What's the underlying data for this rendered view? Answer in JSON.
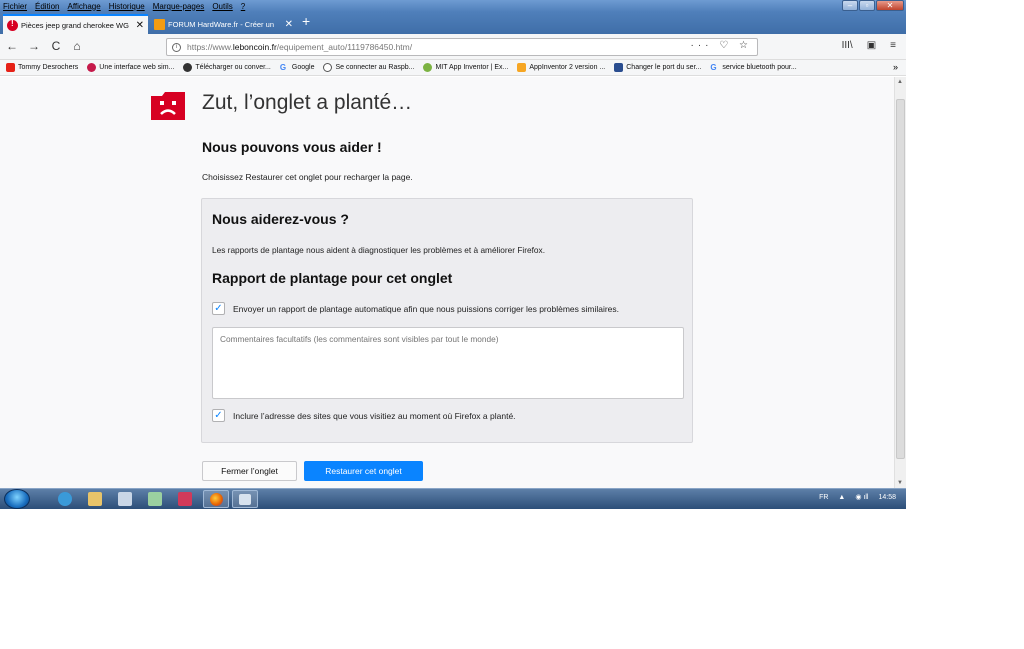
{
  "menu": [
    "Fichier",
    "Édition",
    "Affichage",
    "Historique",
    "Marque-pages",
    "Outils",
    "?"
  ],
  "window_controls": {
    "minimize": "–",
    "maximize": "▫",
    "close": "✕"
  },
  "tabs": [
    {
      "label": "Pièces jeep grand cherokee WG",
      "close": "✕"
    },
    {
      "label": "FORUM HardWare.fr - Créer un",
      "close": "✕"
    }
  ],
  "newtab": "+",
  "nav": {
    "back": "←",
    "forward": "→",
    "reload": "C",
    "home": "⌂"
  },
  "url": {
    "scheme": "https://www.",
    "domain": "leboncoin.fr",
    "path": "/equipement_auto/1119786450.htm/"
  },
  "url_actions": "··· ♡ ☆",
  "toolbar_right": [
    "III\\",
    "▣",
    "≡"
  ],
  "bookmarks": [
    {
      "label": "Tommy Desrochers",
      "color": "#e62117"
    },
    {
      "label": "Une interface web sim...",
      "color": "#c51a4a"
    },
    {
      "label": "Télécharger ou conver...",
      "color": "#333333"
    },
    {
      "label": "Google",
      "color": "#4285f4"
    },
    {
      "label": "Se connecter au Raspb...",
      "color": "#555555"
    },
    {
      "label": "MIT App Inventor | Ex...",
      "color": "#7cb342"
    },
    {
      "label": "AppInventor 2 version ...",
      "color": "#f6a623"
    },
    {
      "label": "Changer le port du ser...",
      "color": "#2a4d8f"
    },
    {
      "label": "service bluetooth pour...",
      "color": "#4285f4"
    }
  ],
  "bookmarks_more": "»",
  "crash": {
    "title": "Zut, l’onglet a planté…",
    "help_title": "Nous pouvons vous aider !",
    "help_text": "Choisissez Restaurer cet onglet pour recharger la page.",
    "box_title": "Nous aiderez-vous ?",
    "box_text": "Les rapports de plantage nous aident à diagnostiquer les problèmes et à améliorer Firefox.",
    "report_title": "Rapport de plantage pour cet onglet",
    "check_send": "Envoyer un rapport de plantage automatique afin que nous puissions corriger les problèmes similaires.",
    "comment_placeholder": "Commentaires facultatifs (les commentaires sont visibles par tout le monde)",
    "check_url": "Inclure l’adresse des sites que vous visitiez au moment où Firefox a planté.",
    "check_mark": "✓",
    "close_button": "Fermer l’onglet",
    "restore_button": "Restaurer cet onglet"
  },
  "taskbar": {
    "lang": "FR",
    "time": "14:58"
  }
}
